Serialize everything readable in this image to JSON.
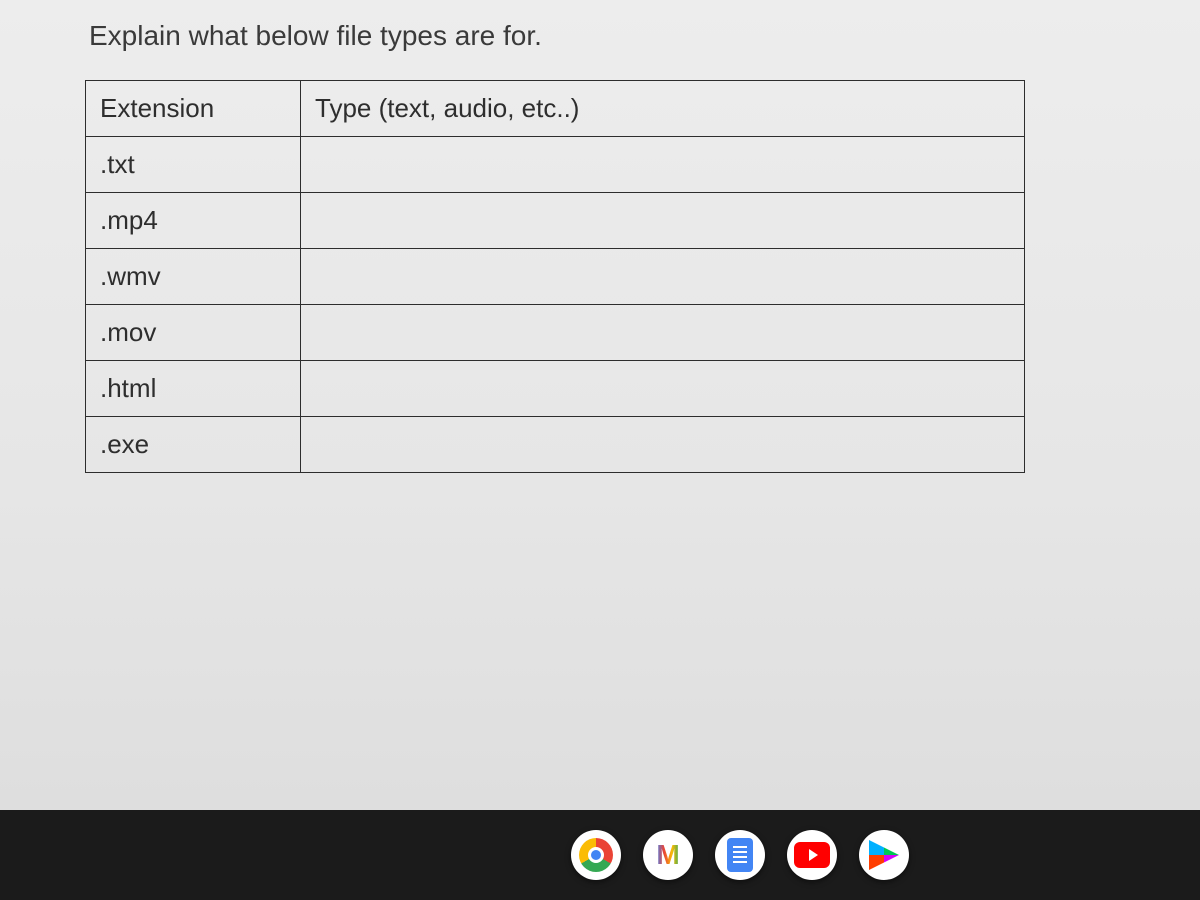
{
  "prompt": "Explain what below file types are for.",
  "table": {
    "headers": {
      "extension": "Extension",
      "type": "Type (text, audio, etc..)"
    },
    "rows": [
      {
        "ext": ".txt",
        "type": ""
      },
      {
        "ext": ".mp4",
        "type": ""
      },
      {
        "ext": ".wmv",
        "type": ""
      },
      {
        "ext": ".mov",
        "type": ""
      },
      {
        "ext": ".html",
        "type": ""
      },
      {
        "ext": ".exe",
        "type": ""
      }
    ]
  },
  "shelf": {
    "icons": [
      "chrome",
      "gmail",
      "docs",
      "youtube",
      "play-store"
    ]
  }
}
